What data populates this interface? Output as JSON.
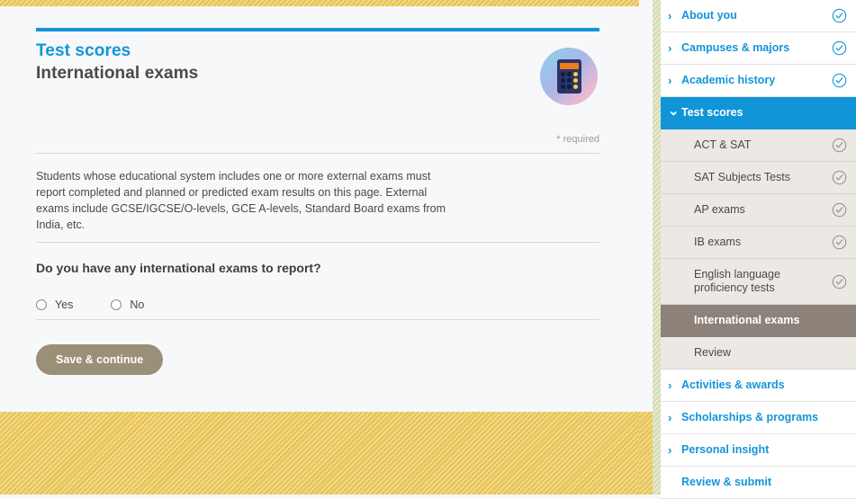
{
  "page": {
    "eyebrow": "Test scores",
    "title": "International exams",
    "required_note": "* required",
    "body_copy": "Students whose educational system includes one or more external exams must report completed and planned or predicted exam results on this page. External exams include GCSE/IGCSE/O-levels, GCE A-levels, Standard Board exams from India, etc.",
    "question": "Do you have any international exams to report?",
    "icon": "calculator-icon"
  },
  "radios": {
    "name": "international-exams",
    "options": [
      {
        "label": "Yes",
        "value": "yes",
        "selected": false
      },
      {
        "label": "No",
        "value": "no",
        "selected": false
      }
    ]
  },
  "actions": {
    "save_label": "Save & continue"
  },
  "sidebar": {
    "items": [
      {
        "label": "About you",
        "type": "top",
        "icon": "chevron-right-icon",
        "chevron": "›",
        "check": "blue",
        "state": "default"
      },
      {
        "label": "Campuses & majors",
        "type": "top",
        "icon": "chevron-right-icon",
        "chevron": "›",
        "check": "blue",
        "state": "default"
      },
      {
        "label": "Academic history",
        "type": "top",
        "icon": "chevron-right-icon",
        "chevron": "›",
        "check": "blue",
        "state": "default"
      },
      {
        "label": "Test scores",
        "type": "top",
        "icon": "chevron-down-icon",
        "chevron": "⌄",
        "check": "none",
        "state": "active-blue"
      },
      {
        "label": "ACT & SAT",
        "type": "sub",
        "icon": "",
        "chevron": "",
        "check": "gray",
        "state": "default"
      },
      {
        "label": "SAT Subjects Tests",
        "type": "sub",
        "icon": "",
        "chevron": "",
        "check": "gray",
        "state": "default"
      },
      {
        "label": "AP exams",
        "type": "sub",
        "icon": "",
        "chevron": "",
        "check": "gray",
        "state": "default"
      },
      {
        "label": "IB exams",
        "type": "sub",
        "icon": "",
        "chevron": "",
        "check": "gray",
        "state": "default"
      },
      {
        "label": "English language proficiency tests",
        "type": "sub-tall",
        "icon": "",
        "chevron": "",
        "check": "gray",
        "state": "default"
      },
      {
        "label": "International exams",
        "type": "sub",
        "icon": "",
        "chevron": "",
        "check": "none",
        "state": "active-gray"
      },
      {
        "label": "Review",
        "type": "sub",
        "icon": "",
        "chevron": "",
        "check": "none",
        "state": "default"
      },
      {
        "label": "Activities & awards",
        "type": "top",
        "icon": "chevron-right-icon",
        "chevron": "›",
        "check": "none",
        "state": "default"
      },
      {
        "label": "Scholarships & programs",
        "type": "top",
        "icon": "chevron-right-icon",
        "chevron": "›",
        "check": "none",
        "state": "default"
      },
      {
        "label": "Personal insight",
        "type": "top",
        "icon": "chevron-right-icon",
        "chevron": "›",
        "check": "none",
        "state": "default"
      },
      {
        "label": "Review & submit",
        "type": "top",
        "icon": "",
        "chevron": "",
        "check": "none",
        "state": "default"
      }
    ]
  },
  "colors": {
    "accent_blue": "#1295d8",
    "active_gray": "#8d8279",
    "button_tan": "#9a8f77",
    "stripe_yellow": "#e9c557",
    "stripe_green": "#d7ddb4",
    "sub_bg": "#ece8e3"
  }
}
